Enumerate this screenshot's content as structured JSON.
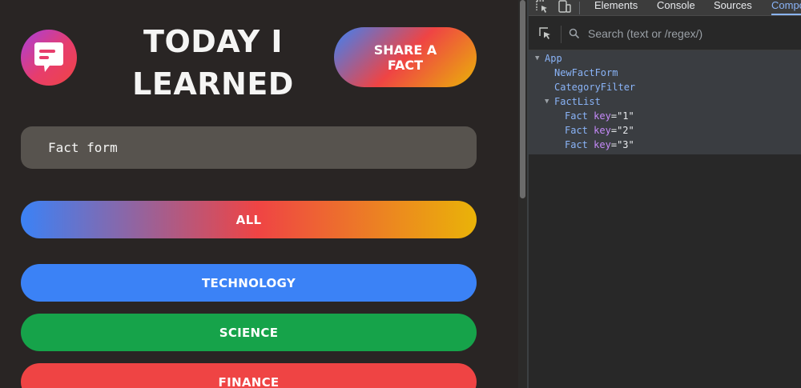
{
  "app": {
    "title": "TODAY I LEARNED",
    "share_button": "SHARE A FACT",
    "fact_form_label": "Fact form",
    "categories": [
      {
        "label": "ALL",
        "color": "gradient"
      },
      {
        "label": "TECHNOLOGY",
        "color": "#3b82f6"
      },
      {
        "label": "SCIENCE",
        "color": "#16a34a"
      },
      {
        "label": "FINANCE",
        "color": "#ef4444"
      }
    ],
    "logo_icon": "chat-bubble-icon"
  },
  "devtools": {
    "tabs": [
      "Elements",
      "Console",
      "Sources",
      "Compo"
    ],
    "active_tab": "Compo",
    "search_placeholder": "Search (text or /regex/)",
    "tree": [
      {
        "name": "App",
        "depth": 0,
        "expanded": true
      },
      {
        "name": "NewFactForm",
        "depth": 1
      },
      {
        "name": "CategoryFilter",
        "depth": 1
      },
      {
        "name": "FactList",
        "depth": 1,
        "expanded": true
      },
      {
        "name": "Fact",
        "depth": 2,
        "key_attr": "key",
        "key_value": "\"1\""
      },
      {
        "name": "Fact",
        "depth": 2,
        "key_attr": "key",
        "key_value": "\"2\""
      },
      {
        "name": "Fact",
        "depth": 2,
        "key_attr": "key",
        "key_value": "\"3\""
      }
    ]
  },
  "colors": {
    "app_background": "#292524",
    "fact_form_background": "#57534e",
    "devtools_accent": "#8ab4f8"
  }
}
